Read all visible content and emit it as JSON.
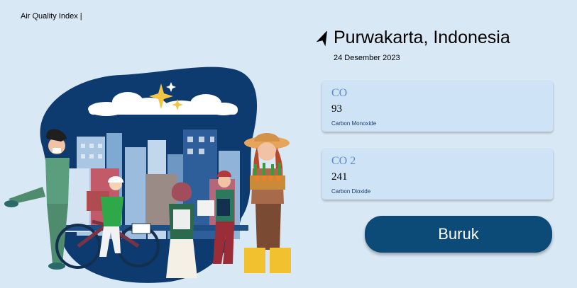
{
  "app": {
    "title": "Air Quality Index |"
  },
  "location": {
    "city": "Purwakarta, Indonesia",
    "date": "24 Desember 2023",
    "icon": "navigation-arrow-icon"
  },
  "readings": [
    {
      "code": "CO",
      "value": "93",
      "description": "Carbon Monoxide"
    },
    {
      "code": "CO 2",
      "value": "241",
      "description": "Carbon Dioxide"
    }
  ],
  "status": {
    "label": "Buruk",
    "color": "#0c4a77"
  },
  "colors": {
    "background": "#d9e8f5",
    "card": "#cfe3f7",
    "accent": "#5a8fc3",
    "blob": "#0d3b70"
  }
}
